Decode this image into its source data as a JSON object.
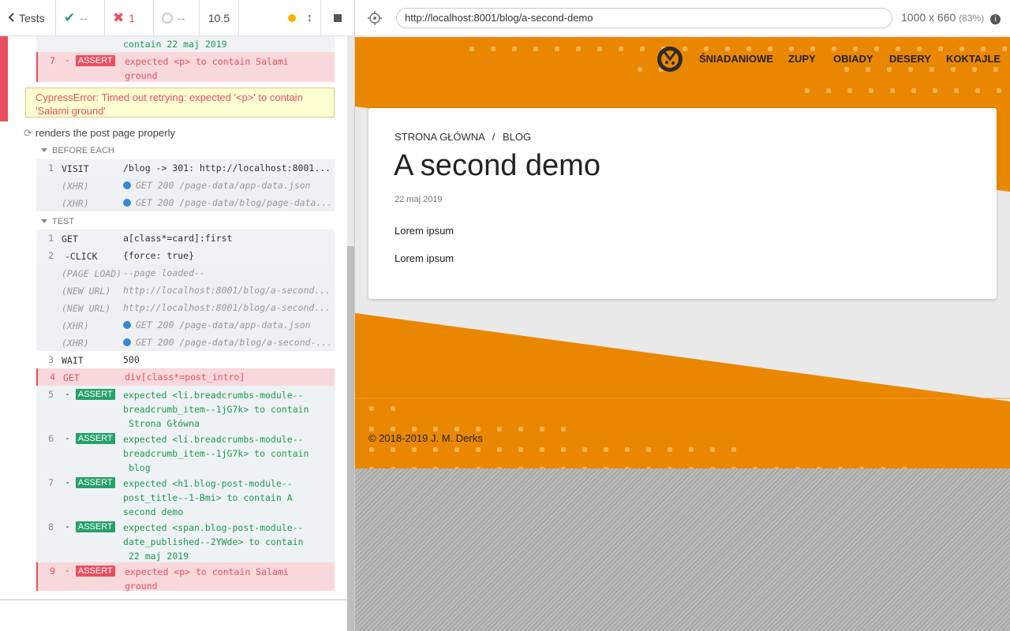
{
  "reporter": {
    "back_label": "Tests",
    "passed": "--",
    "failed": "1",
    "pending": "--",
    "duration": "10.5",
    "top_rows": [
      {
        "cont": "contain  22 maj 2019"
      },
      {
        "num": "7",
        "cmd": "ASSERT",
        "msg1": "expected  <p>  to contain  Salami",
        "msg2": "ground"
      }
    ],
    "error_message": "CypressError: Timed out retrying: expected '<p>' to contain 'Salami ground'",
    "test_title": "renders the post page properly",
    "before_each_label": "BEFORE EACH",
    "test_label": "TEST",
    "before_rows": [
      {
        "num": "1",
        "cmd": "VISIT",
        "msg": "/blog -> 301: http://localhost:8001..."
      },
      {
        "num": "",
        "cmd": "(XHR)",
        "msg": "GET 200 /page-data/app-data.json"
      },
      {
        "num": "",
        "cmd": "(XHR)",
        "msg": "GET 200 /page-data/blog/page-data..."
      }
    ],
    "test_rows": [
      {
        "num": "1",
        "cmd": "GET",
        "msg": "a[class*=card]:first"
      },
      {
        "num": "2",
        "cmd": "-CLICK",
        "msg": "{force: true}"
      },
      {
        "num": "",
        "cmd": "(PAGE LOAD)",
        "msg": "--page loaded--"
      },
      {
        "num": "",
        "cmd": "(NEW URL)",
        "msg": "http://localhost:8001/blog/a-second..."
      },
      {
        "num": "",
        "cmd": "(NEW URL)",
        "msg": "http://localhost:8001/blog/a-second..."
      },
      {
        "num": "",
        "cmd": "(XHR)",
        "msg": "GET 200 /page-data/app-data.json"
      },
      {
        "num": "",
        "cmd": "(XHR)",
        "msg": "GET 200 /page-data/blog/a-second-..."
      },
      {
        "num": "3",
        "cmd": "WAIT",
        "msg": "500"
      },
      {
        "num": "4",
        "cmd": "GET",
        "msg": "div[class*=post_intro]"
      }
    ],
    "asserts": [
      {
        "num": "5",
        "cmd": "ASSERT",
        "l1": "expected  <li.breadcrumbs-module--",
        "l2": "breadcrumb_item--1jG7k>  to contain",
        "l3": "Strona Główna"
      },
      {
        "num": "6",
        "cmd": "ASSERT",
        "l1": "expected  <li.breadcrumbs-module--",
        "l2": "breadcrumb_item--1jG7k>  to contain",
        "l3": "blog"
      },
      {
        "num": "7",
        "cmd": "ASSERT",
        "l1": "expected  <h1.blog-post-module--",
        "l2": "post_title--1-Bmi>  to contain  A",
        "l3": "second demo"
      },
      {
        "num": "8",
        "cmd": "ASSERT",
        "l1": "expected  <span.blog-post-module--",
        "l2": "date_published--2YWde>  to contain",
        "l3": "22 maj 2019"
      },
      {
        "num": "9",
        "cmd": "ASSERT",
        "l1": "expected  <p>  to contain  Salami",
        "l2": "ground",
        "l3": ""
      }
    ]
  },
  "browser": {
    "url": "http://localhost:8001/blog/a-second-demo",
    "viewport": "1000 x 660",
    "zoom": "(83%)"
  },
  "site": {
    "nav": [
      "ŚNIADANIOWE",
      "ZUPY",
      "OBIADY",
      "DESERY",
      "KOKTAJLE"
    ],
    "breadcrumb_home": "STRONA GŁÓWNA",
    "breadcrumb_sep": "/",
    "breadcrumb_blog": "BLOG",
    "title": "A second demo",
    "date": "22 maj 2019",
    "paragraphs": [
      "Lorem ipsum",
      "Lorem ipsum"
    ],
    "copyright": "© 2018-2019 J. M. Derks"
  },
  "colors": {
    "brand_orange": "#ea8700",
    "fail_red": "#e94f5f",
    "pass_green": "#27a16a"
  }
}
